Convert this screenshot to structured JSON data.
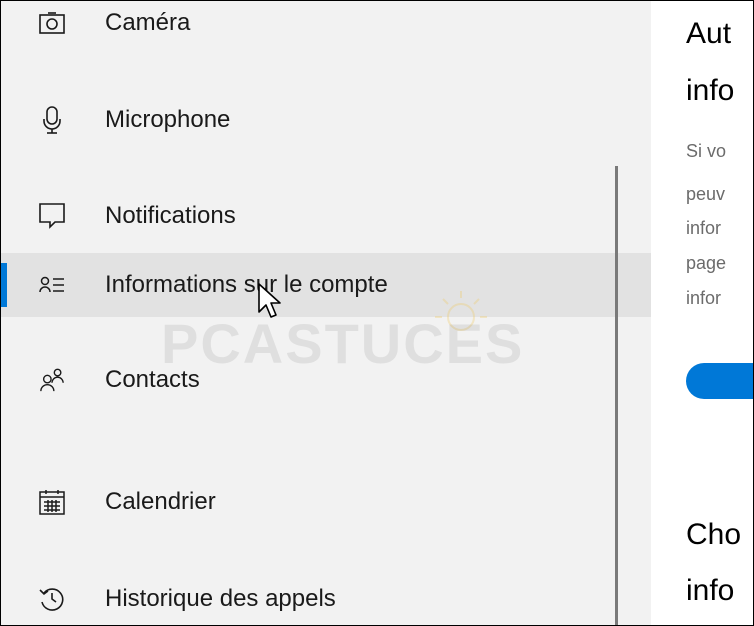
{
  "sidebar": {
    "items": [
      {
        "label": "Caméra",
        "icon": "camera-icon",
        "selected": false
      },
      {
        "label": "Microphone",
        "icon": "microphone-icon",
        "selected": false
      },
      {
        "label": "Notifications",
        "icon": "notifications-icon",
        "selected": false
      },
      {
        "label": "Informations sur le compte",
        "icon": "account-info-icon",
        "selected": true
      },
      {
        "label": "Contacts",
        "icon": "contacts-icon",
        "selected": false
      },
      {
        "label": "Calendrier",
        "icon": "calendar-icon",
        "selected": false
      },
      {
        "label": "Historique des appels",
        "icon": "history-icon",
        "selected": false
      }
    ]
  },
  "watermark": {
    "text": "PCASTUCES"
  },
  "content": {
    "heading1": [
      "Aut",
      "info"
    ],
    "description": [
      "Si vo",
      "peuv",
      "infor",
      "page",
      "infor"
    ],
    "toggle_state": "on",
    "heading2": [
      "Cho",
      "info"
    ]
  },
  "colors": {
    "accent": "#0078d7",
    "sidebar_bg": "#f2f2f2",
    "selected_bg": "#e2e2e2",
    "text": "#1a1a1a",
    "description": "#6b6b6b"
  }
}
